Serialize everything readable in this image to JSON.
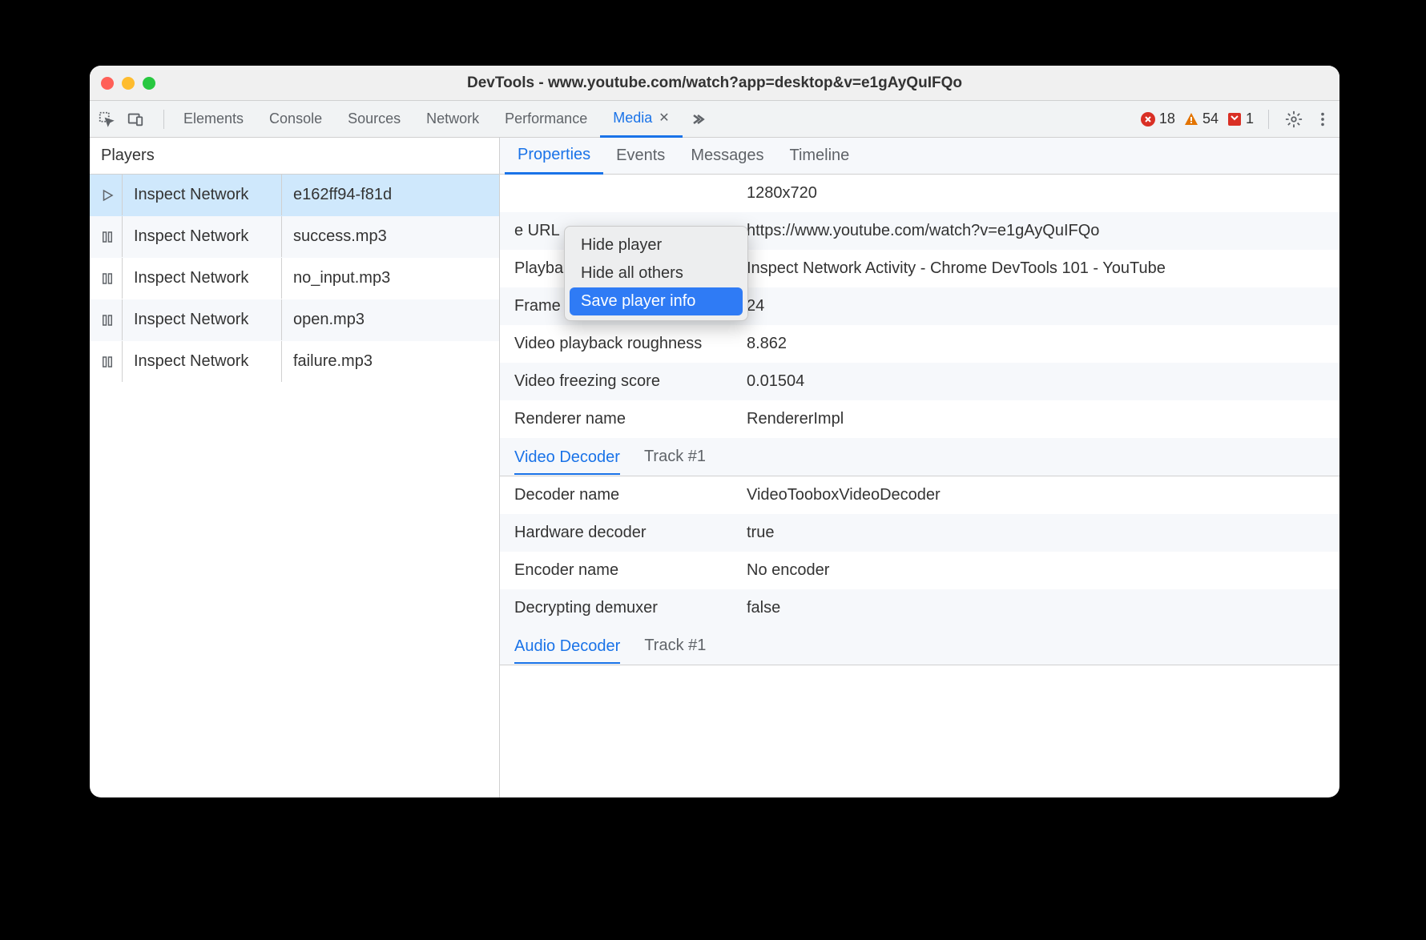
{
  "window": {
    "title": "DevTools - www.youtube.com/watch?app=desktop&v=e1gAyQuIFQo"
  },
  "toolbar": {
    "tabs": [
      {
        "label": "Elements",
        "active": false
      },
      {
        "label": "Console",
        "active": false
      },
      {
        "label": "Sources",
        "active": false
      },
      {
        "label": "Network",
        "active": false
      },
      {
        "label": "Performance",
        "active": false
      },
      {
        "label": "Media",
        "active": true
      }
    ],
    "badges": {
      "errors": "18",
      "warnings": "54",
      "issues": "1"
    }
  },
  "sidebar": {
    "header": "Players",
    "players": [
      {
        "name": "Inspect Network",
        "file": "e162ff94-f81d",
        "icon": "play",
        "selected": true
      },
      {
        "name": "Inspect Network",
        "file": "success.mp3",
        "icon": "pause"
      },
      {
        "name": "Inspect Network",
        "file": "no_input.mp3",
        "icon": "pause"
      },
      {
        "name": "Inspect Network",
        "file": "open.mp3",
        "icon": "pause"
      },
      {
        "name": "Inspect Network",
        "file": "failure.mp3",
        "icon": "pause"
      }
    ]
  },
  "subtabs": [
    {
      "label": "Properties",
      "active": true
    },
    {
      "label": "Events"
    },
    {
      "label": "Messages"
    },
    {
      "label": "Timeline"
    }
  ],
  "properties": {
    "rows": [
      {
        "label": "",
        "value": "1280x720",
        "visibleLabel": ""
      },
      {
        "label": "e URL",
        "value": "https://www.youtube.com/watch?v=e1gAyQuIFQo",
        "wrap": true
      },
      {
        "label": "Playback frame title",
        "value": "Inspect Network Activity - Chrome DevTools 101 - YouTube",
        "wrap": true
      },
      {
        "label": "Frame rate",
        "value": "24"
      },
      {
        "label": "Video playback roughness",
        "value": "8.862"
      },
      {
        "label": "Video freezing score",
        "value": "0.01504"
      },
      {
        "label": "Renderer name",
        "value": "RendererImpl"
      }
    ],
    "videoDecoder": {
      "title": "Video Decoder",
      "track": "Track #1",
      "rows": [
        {
          "label": "Decoder name",
          "value": "VideoTooboxVideoDecoder"
        },
        {
          "label": "Hardware decoder",
          "value": "true"
        },
        {
          "label": "Encoder name",
          "value": "No encoder"
        },
        {
          "label": "Decrypting demuxer",
          "value": "false"
        }
      ]
    },
    "audioDecoder": {
      "title": "Audio Decoder",
      "track": "Track #1"
    }
  },
  "contextMenu": {
    "items": [
      {
        "label": "Hide player",
        "highlighted": false
      },
      {
        "label": "Hide all others",
        "highlighted": false
      },
      {
        "label": "Save player info",
        "highlighted": true
      }
    ]
  }
}
